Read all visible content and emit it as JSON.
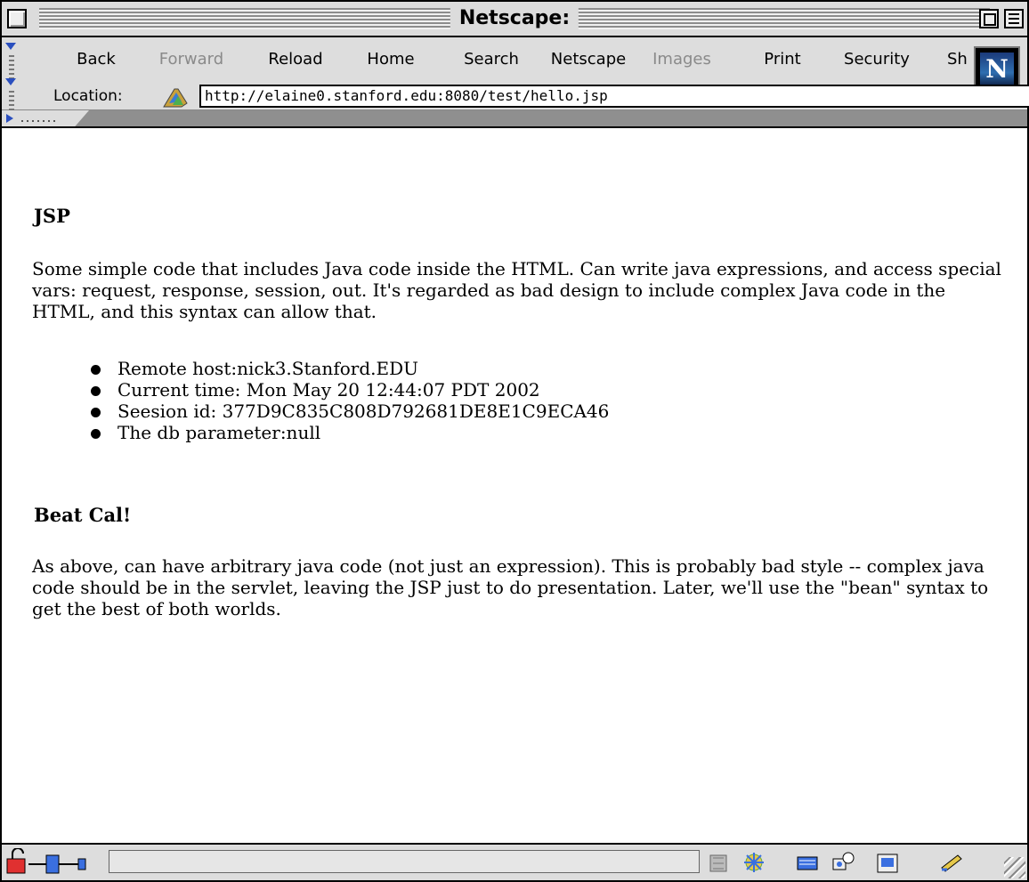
{
  "window": {
    "title": "Netscape:"
  },
  "toolbar": {
    "buttons": [
      {
        "label": "Back",
        "enabled": true
      },
      {
        "label": "Forward",
        "enabled": false
      },
      {
        "label": "Reload",
        "enabled": true
      },
      {
        "label": "Home",
        "enabled": true
      },
      {
        "label": "Search",
        "enabled": true
      },
      {
        "label": "Netscape",
        "enabled": true
      },
      {
        "label": "Images",
        "enabled": false
      },
      {
        "label": "Print",
        "enabled": true
      },
      {
        "label": "Security",
        "enabled": true
      },
      {
        "label": "Sh",
        "enabled": true
      }
    ],
    "logo_letter": "N",
    "location_label": "Location:",
    "location_url": "http://elaine0.stanford.edu:8080/test/hello.jsp"
  },
  "page": {
    "heading1": "JSP",
    "para1": "Some simple code that includes Java code inside the HTML. Can write java expressions, and access special vars: request, response, session, out. It's regarded as bad design to include complex Java code in the HTML, and this syntax can allow that.",
    "list": [
      "Remote host:nick3.Stanford.EDU",
      "Current time: Mon May 20 12:44:07 PDT 2002",
      "Seesion id: 377D9C835C808D792681DE8E1C9ECA46",
      "The db parameter:null"
    ],
    "heading2": "Beat Cal!",
    "para2": "As above, can have arbitrary java code (not just an expression). This is probably bad style -- complex java code should be in the servlet, leaving the JSP just to do presentation. Later, we'll use the \"bean\" syntax to get the best of both worlds."
  },
  "statusbar": {
    "message": "",
    "icons": [
      "security-lock-icon",
      "connection-plug-icon",
      "navigator-icon",
      "mail-icon",
      "newsgroups-icon",
      "composer-icon",
      "editor-pen-icon"
    ]
  },
  "colors": {
    "accent_blue": "#2a4fbf",
    "chrome_gray": "#dddddd",
    "content_bg": "#ffffff"
  }
}
